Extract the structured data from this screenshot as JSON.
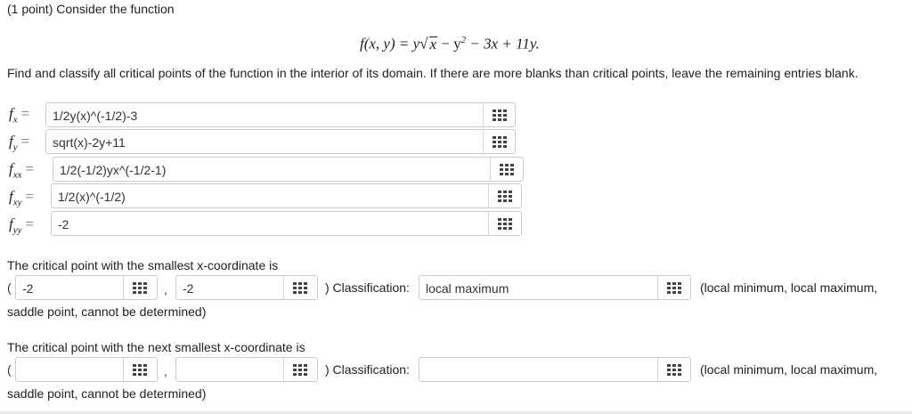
{
  "header": {
    "text": "(1 point) Consider the function"
  },
  "formula": {
    "lhs": "f(x, y) =",
    "term1": "y",
    "sqrt_arg": "x",
    "part2": "− y",
    "exp2": "2",
    "part3": "− 3x + 11y."
  },
  "instructions": "Find and classify all critical points of the function in the interior of its domain. If there are more blanks than critical points, leave the remaining entries blank.",
  "derivatives": {
    "fx": {
      "base": "f",
      "sub": "x",
      "eq": "=",
      "value": "1/2y(x)^(-1/2)-3"
    },
    "fy": {
      "base": "f",
      "sub": "y",
      "eq": "=",
      "value": "sqrt(x)-2y+11"
    },
    "fxx": {
      "base": "f",
      "sub": "xx",
      "eq": "=",
      "value": "1/2(-1/2)yx^(-1/2-1)"
    },
    "fxy": {
      "base": "f",
      "sub": "xy",
      "eq": "=",
      "value": "1/2(x)^(-1/2)"
    },
    "fyy": {
      "base": "f",
      "sub": "yy",
      "eq": "=",
      "value": "-2"
    }
  },
  "point1": {
    "prompt": "The critical point with the smallest x-coordinate is",
    "open": "(",
    "x": "-2",
    "comma": ",",
    "y": "-2",
    "close_label": ") Classification:",
    "classification": "local maximum",
    "options_a": "(local minimum, local maximum,",
    "options_b": "saddle point, cannot be determined)"
  },
  "point2": {
    "prompt": "The critical point with the next smallest x-coordinate is",
    "open": "(",
    "x": "",
    "comma": ",",
    "y": "",
    "close_label": ") Classification:",
    "classification": "",
    "options_a": "(local minimum, local maximum,",
    "options_b": "saddle point, cannot be determined)"
  },
  "icons": {
    "equation_editor": "grid-icon"
  },
  "colors": {
    "border": "#cccccc",
    "icon": "#444444",
    "text": "#222222"
  }
}
